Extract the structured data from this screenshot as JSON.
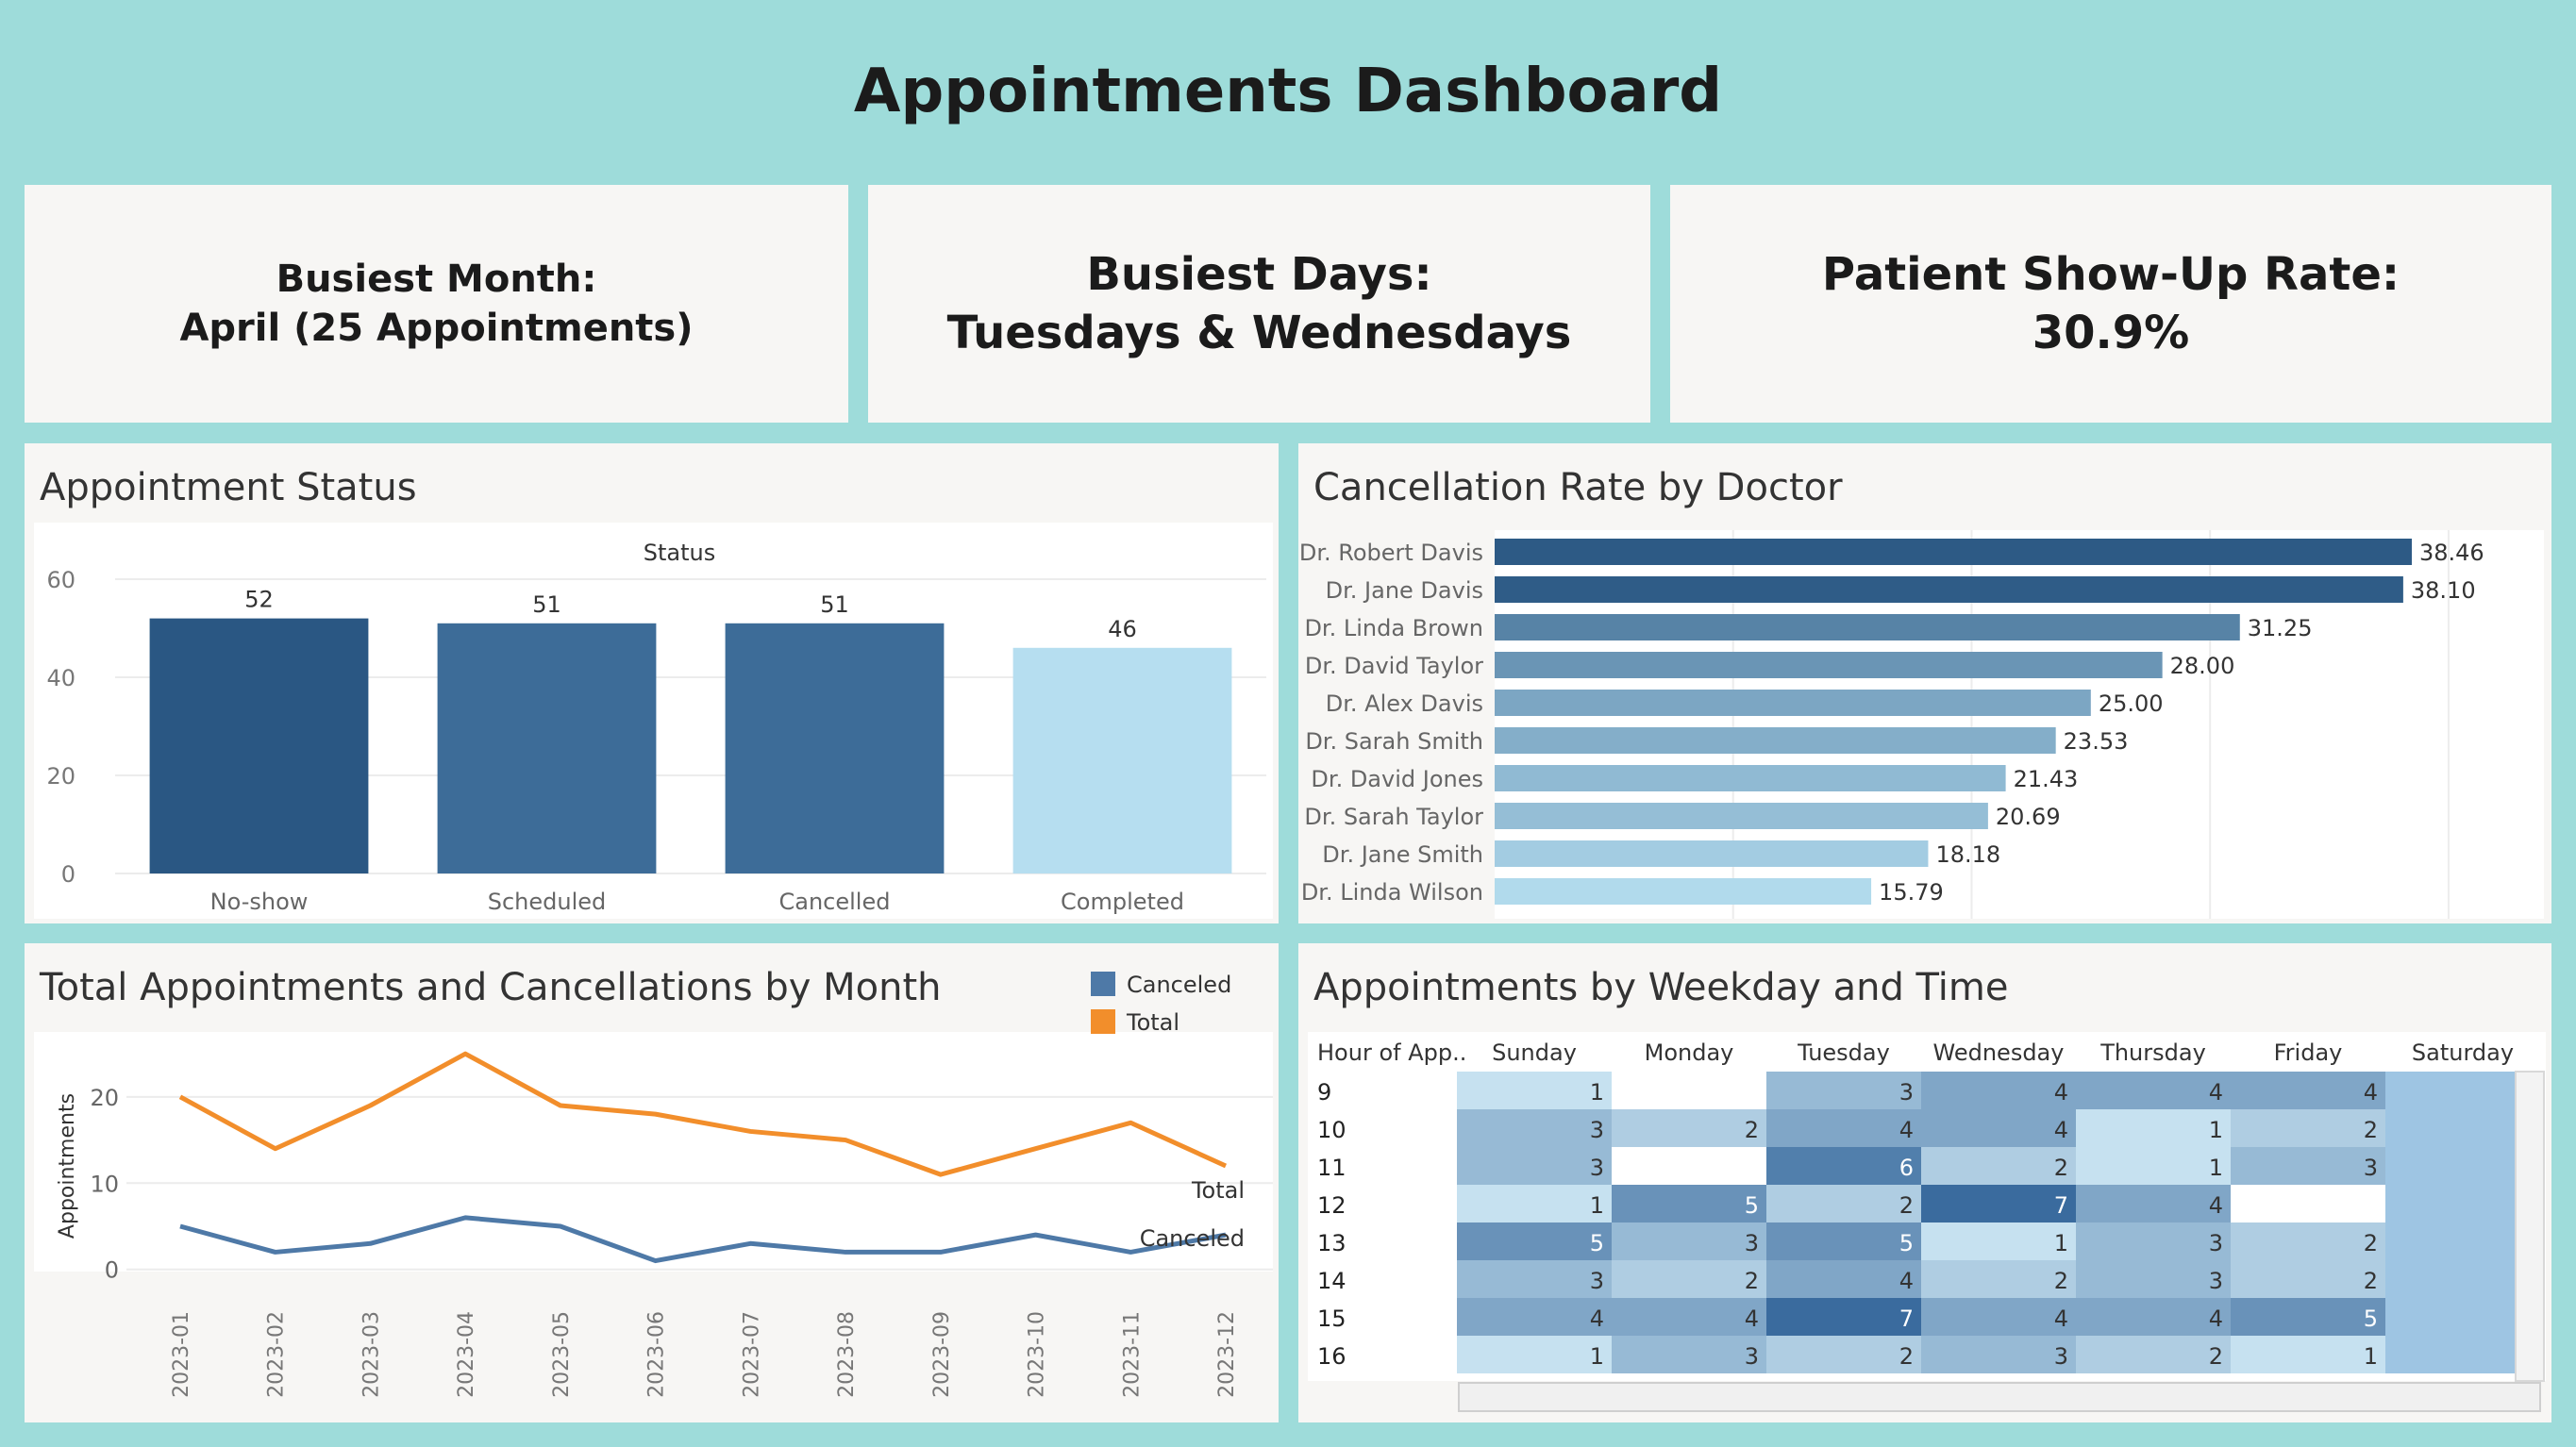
{
  "title": "Appointments Dashboard",
  "kpis": [
    {
      "line1": "Busiest Month:",
      "line2": "April (25 Appointments)"
    },
    {
      "line1": "Busiest Days:",
      "line2": "Tuesdays & Wednesdays"
    },
    {
      "line1": "Patient Show-Up Rate:",
      "line2": "30.9%"
    }
  ],
  "colors": {
    "background": "#9edcda",
    "panel": "#f7f6f4",
    "dark_blue": "#2a5783",
    "mid_blue": "#3d6c98",
    "light_blue": "#b6def0",
    "orange": "#f28e2b",
    "line_blue": "#4e79a7"
  },
  "status_panel": {
    "title": "Appointment Status"
  },
  "doctor_panel": {
    "title": "Cancellation Rate by Doctor"
  },
  "monthly_panel": {
    "title": "Total Appointments and Cancellations by Month"
  },
  "heatmap_panel": {
    "title": "Appointments by Weekday and Time"
  },
  "chart_data": [
    {
      "type": "bar",
      "title": "Appointment Status",
      "subtitle": "Status",
      "categories": [
        "No-show",
        "Scheduled",
        "Cancelled",
        "Completed"
      ],
      "values": [
        52,
        51,
        51,
        46
      ],
      "ylim": [
        0,
        60
      ],
      "yticks": [
        0,
        20,
        40,
        60
      ],
      "colors": [
        "#2a5783",
        "#3d6c98",
        "#3d6c98",
        "#b6def0"
      ]
    },
    {
      "type": "bar",
      "orientation": "horizontal",
      "title": "Cancellation Rate by Doctor",
      "categories": [
        "Dr. Robert Davis",
        "Dr. Jane Davis",
        "Dr. Linda Brown",
        "Dr. David Taylor",
        "Dr. Alex Davis",
        "Dr. Sarah Smith",
        "Dr. David Jones",
        "Dr. Sarah Taylor",
        "Dr. Jane Smith",
        "Dr. Linda Wilson"
      ],
      "values": [
        38.46,
        38.1,
        31.25,
        28.0,
        25.0,
        23.53,
        21.43,
        20.69,
        18.18,
        15.79
      ],
      "labels": [
        "38.46",
        "38.10",
        "31.25",
        "28.00",
        "25.00",
        "23.53",
        "21.43",
        "20.69",
        "18.18",
        "15.79"
      ],
      "xlim": [
        0,
        44
      ]
    },
    {
      "type": "line",
      "title": "Total Appointments and Cancellations by Month",
      "x": [
        "2023-01",
        "2023-02",
        "2023-03",
        "2023-04",
        "2023-05",
        "2023-06",
        "2023-07",
        "2023-08",
        "2023-09",
        "2023-10",
        "2023-11",
        "2023-12"
      ],
      "ylabel": "Appointments",
      "ylim": [
        -2,
        26
      ],
      "yticks": [
        0,
        10,
        20
      ],
      "legend": [
        "Canceled",
        "Total"
      ],
      "series": [
        {
          "name": "Total",
          "values": [
            20,
            14,
            19,
            25,
            19,
            18,
            16,
            15,
            11,
            14,
            17,
            12
          ],
          "color": "#f28e2b"
        },
        {
          "name": "Canceled",
          "values": [
            5,
            2,
            3,
            6,
            5,
            1,
            3,
            2,
            2,
            4,
            2,
            4
          ],
          "color": "#4e79a7"
        }
      ]
    },
    {
      "type": "heatmap",
      "title": "Appointments by Weekday and Time",
      "row_header": "Hour of App..",
      "columns": [
        "Sunday",
        "Monday",
        "Tuesday",
        "Wednesday",
        "Thursday",
        "Friday",
        "Saturday"
      ],
      "rows": [
        "9",
        "10",
        "11",
        "12",
        "13",
        "14",
        "15",
        "16"
      ],
      "values": [
        [
          1,
          null,
          3,
          4,
          4,
          4,
          null
        ],
        [
          3,
          2,
          4,
          4,
          1,
          2,
          null
        ],
        [
          3,
          null,
          6,
          2,
          1,
          3,
          null
        ],
        [
          1,
          5,
          2,
          7,
          4,
          null,
          null
        ],
        [
          5,
          3,
          5,
          1,
          3,
          2,
          null
        ],
        [
          3,
          2,
          4,
          2,
          3,
          2,
          null
        ],
        [
          4,
          4,
          7,
          4,
          4,
          5,
          null
        ],
        [
          1,
          3,
          2,
          3,
          2,
          1,
          null
        ]
      ]
    }
  ]
}
